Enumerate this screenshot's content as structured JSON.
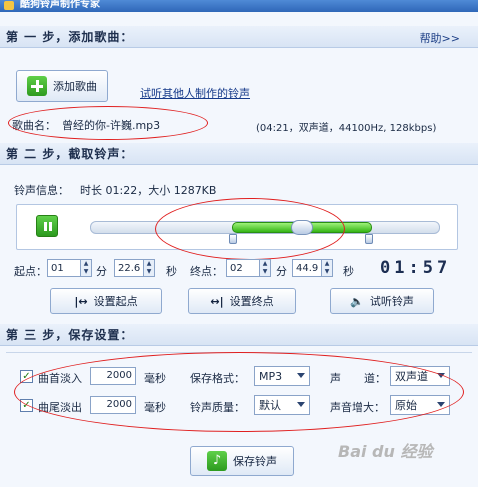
{
  "window": {
    "title": "酷狗铃声制作专家"
  },
  "help_label": "帮助>>",
  "step1": {
    "header": "第 一 步，添加歌曲：",
    "add_button": "添加歌曲",
    "try_link": "试听其他人制作的铃声",
    "song_name_label": "歌曲名：",
    "song_name_value": "曾经的你-许巍.mp3",
    "song_info": "(04:21，双声道，44100Hz,  128kbps)"
  },
  "step2": {
    "header": "第 二 步，截取铃声：",
    "ringtone_info_label": "铃声信息：",
    "ringtone_info_value": "时长 01:22，大小  1287KB",
    "start_label": "起点：",
    "start_min": "01",
    "min_unit": "分",
    "start_sec": "22.6",
    "sec_unit": "秒",
    "end_label": "终点：",
    "end_min": "02",
    "end_sec": "44.9",
    "time_display": "01:57",
    "selection_start_fraction": 0.47,
    "selection_end_fraction": 0.8,
    "set_start_button": "设置起点",
    "set_end_button": "设置终点",
    "preview_button": "试听铃声"
  },
  "step3": {
    "header": "第 三 步，保存设置：",
    "fade_in_label": "曲首淡入",
    "fade_in_value": "2000",
    "fade_out_label": "曲尾淡出",
    "fade_out_value": "2000",
    "ms_unit": "毫秒",
    "format_label": "保存格式：",
    "format_value": "MP3",
    "quality_label": "铃声质量：",
    "quality_value": "默认",
    "channel_label_1": "声",
    "channel_label_2": "道：",
    "channel_value": "双声道",
    "volume_label": "声音增大：",
    "volume_value": "原始",
    "save_button": "保存铃声"
  },
  "watermark": "Bai du 经验",
  "colors": {
    "accent_green": "#34b515",
    "annotation_red": "#e02020",
    "header_bg": "#d8e4f4"
  }
}
